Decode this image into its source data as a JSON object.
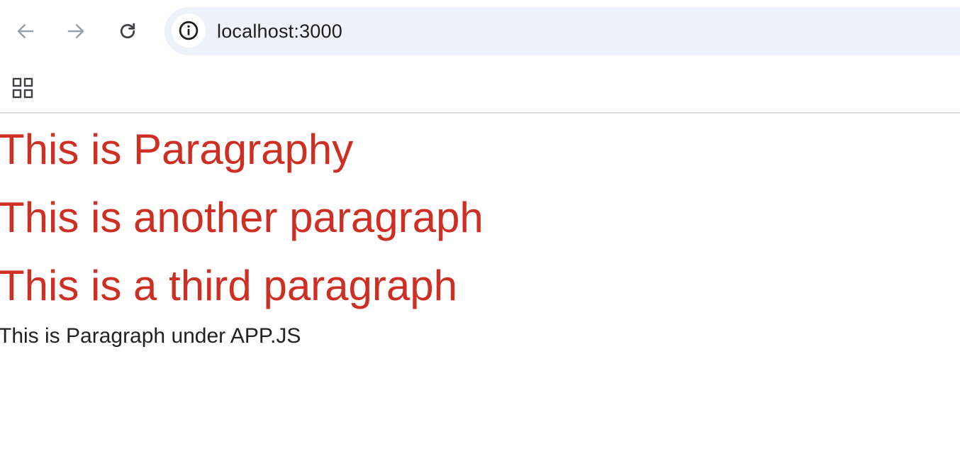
{
  "browser": {
    "url": "localhost:3000",
    "icons": {
      "back": "arrow-left-icon",
      "forward": "arrow-right-icon",
      "reload": "reload-icon",
      "site_info": "info-icon",
      "apps": "apps-grid-icon"
    }
  },
  "page": {
    "paragraphs": [
      "This is Paragraphy",
      "This is another paragraph",
      "This is a third paragraph"
    ],
    "app_paragraph": "This is Paragraph under APP.JS"
  },
  "colors": {
    "paragraph_red": "#cf2e23",
    "body_text": "#222222",
    "omnibox_bg": "#edf2fa"
  }
}
